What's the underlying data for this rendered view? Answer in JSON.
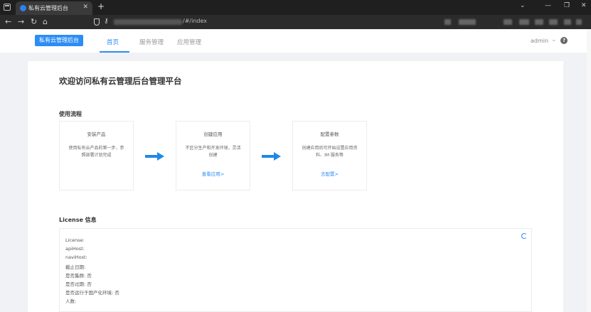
{
  "browser": {
    "tab_title": "私有云管理后台",
    "tab_close": "✕",
    "new_tab": "+",
    "url_suffix": "/#/index",
    "controls": {
      "minimize": "—",
      "restore": "❐",
      "close": "✕",
      "menu": "⌄"
    },
    "nav": {
      "back": "←",
      "forward": "→",
      "reload": "↻",
      "home": "⌂"
    },
    "key_glyph": "⚷"
  },
  "header": {
    "brand": "私有云管理后台",
    "tabs": [
      {
        "label": "首页"
      },
      {
        "label": "服务管理"
      },
      {
        "label": "应用管理"
      }
    ],
    "user": "admin",
    "chevron": "⌄",
    "help": "?"
  },
  "main": {
    "title": "欢迎访问私有云管理后台管理平台",
    "flow_heading": "使用流程",
    "steps": [
      {
        "title": "安装产品",
        "desc": "使用私有云产品的第一步，参照部署计划完成",
        "link": ""
      },
      {
        "title": "创建应用",
        "desc": "不区分生产和开发环境，灵活创建",
        "link": "查看应用>"
      },
      {
        "title": "配置参数",
        "desc": "创建应用后可开始设置应用资料、IM 服务等",
        "link": "去配置>"
      }
    ],
    "license_heading": "License 信息",
    "license_rows": [
      "License:",
      "apiHost:",
      "naviHost:",
      "截止日期:",
      "是否集群: 否",
      "是否过期: 否",
      "是否运行于国产化环境: 否",
      "人数:"
    ]
  },
  "colors": {
    "accent": "#2c8df4",
    "arrow": "#1f8ae6"
  }
}
